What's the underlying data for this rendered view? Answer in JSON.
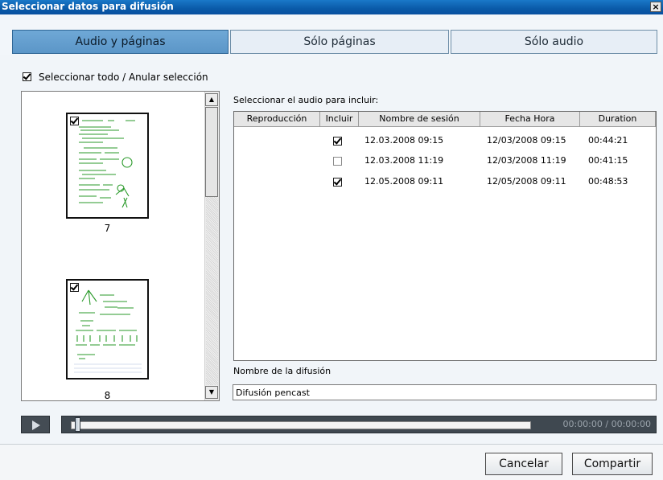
{
  "window": {
    "title": "Seleccionar datos para difusión",
    "close_glyph": "×"
  },
  "tabs": [
    {
      "label": "Audio y páginas",
      "active": true
    },
    {
      "label": "Sólo páginas",
      "active": false
    },
    {
      "label": "Sólo audio",
      "active": false
    }
  ],
  "select_all": {
    "label": "Seleccionar todo / Anular selección",
    "checked": true
  },
  "pages": [
    {
      "number": "7",
      "checked": true
    },
    {
      "number": "8",
      "checked": true
    }
  ],
  "audio": {
    "label": "Seleccionar el audio para incluir:",
    "columns": [
      "Reproducción",
      "Incluir",
      "Nombre de sesión",
      "Fecha Hora",
      "Duration"
    ],
    "rows": [
      {
        "include": true,
        "session": "12.03.2008 09:15",
        "datetime": "12/03/2008 09:15",
        "duration": "00:44:21"
      },
      {
        "include": false,
        "session": "12.03.2008 11:19",
        "datetime": "12/03/2008 11:19",
        "duration": "00:41:15"
      },
      {
        "include": true,
        "session": "12.05.2008 09:11",
        "datetime": "12/05/2008 09:11",
        "duration": "00:48:53"
      }
    ]
  },
  "broadcast": {
    "label": "Nombre de la difusión",
    "value": "Difusión pencast"
  },
  "player": {
    "time": "00:00:00 / 00:00:00",
    "progress": 0
  },
  "buttons": {
    "cancel": "Cancelar",
    "share": "Compartir"
  },
  "colors": {
    "accent": "#5b96c8",
    "title_bar": "#0a5aa8",
    "player": "#3f4850",
    "ink": "#2a9a2a"
  }
}
